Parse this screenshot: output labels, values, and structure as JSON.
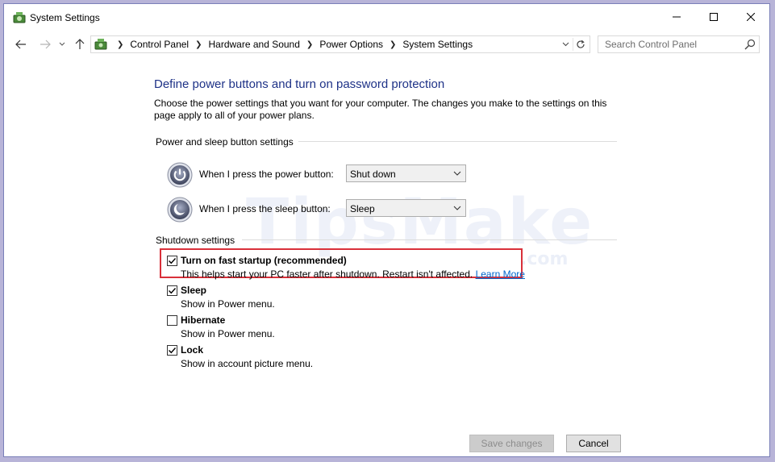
{
  "window": {
    "title": "System Settings"
  },
  "navigation": {
    "breadcrumbs": [
      "Control Panel",
      "Hardware and Sound",
      "Power Options",
      "System Settings"
    ],
    "search_placeholder": "Search Control Panel"
  },
  "page": {
    "heading": "Define power buttons and turn on password protection",
    "description": "Choose the power settings that you want for your computer. The changes you make to the settings on this page apply to all of your power plans."
  },
  "power_section": {
    "title": "Power and sleep button settings",
    "power_button": {
      "label": "When I press the power button:",
      "value": "Shut down"
    },
    "sleep_button": {
      "label": "When I press the sleep button:",
      "value": "Sleep"
    }
  },
  "shutdown_section": {
    "title": "Shutdown settings",
    "options": [
      {
        "label": "Turn on fast startup (recommended)",
        "help": "This helps start your PC faster after shutdown. Restart isn't affected.",
        "link": "Learn More",
        "checked": true
      },
      {
        "label": "Sleep",
        "help": "Show in Power menu.",
        "checked": true
      },
      {
        "label": "Hibernate",
        "help": "Show in Power menu.",
        "checked": false
      },
      {
        "label": "Lock",
        "help": "Show in account picture menu.",
        "checked": true
      }
    ]
  },
  "footer": {
    "save_label": "Save changes",
    "cancel_label": "Cancel"
  },
  "watermark": {
    "brand": "TipsMake",
    "domain": ".com"
  },
  "colors": {
    "heading": "#1e3287",
    "link": "#0066cc",
    "highlight": "#d9303a"
  }
}
